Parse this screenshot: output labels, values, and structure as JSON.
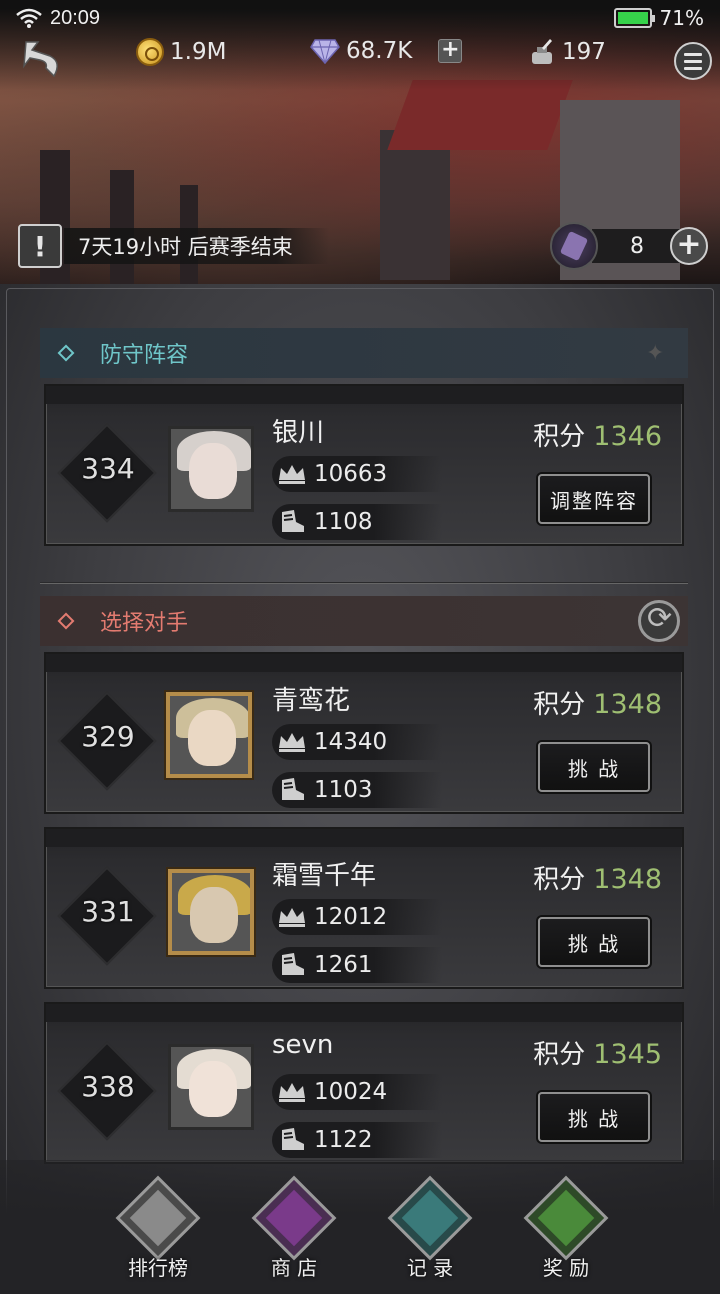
{
  "status_bar": {
    "time": "20:09",
    "battery": "71%"
  },
  "currency": {
    "gold": "1.9M",
    "gems": "68.7K",
    "ink": "197"
  },
  "season": {
    "text": "7天19小时 后赛季结束",
    "tickets": "8"
  },
  "defense": {
    "title": "防守阵容",
    "player": {
      "rank": "334",
      "name": "银川",
      "power": "10663",
      "level": "1108",
      "score_label": "积分",
      "score": "1346",
      "button": "调整阵容"
    }
  },
  "opponents": {
    "title": "选择对手",
    "list": [
      {
        "rank": "329",
        "name": "青鸾花",
        "power": "14340",
        "level": "1103",
        "score_label": "积分",
        "score": "1348",
        "button": "挑 战"
      },
      {
        "rank": "331",
        "name": "霜雪千年",
        "power": "12012",
        "level": "1261",
        "score_label": "积分",
        "score": "1348",
        "button": "挑 战"
      },
      {
        "rank": "338",
        "name": "sevn",
        "power": "10024",
        "level": "1122",
        "score_label": "积分",
        "score": "1345",
        "button": "挑 战"
      }
    ]
  },
  "nav": [
    {
      "label": "排行榜",
      "color": "#8a8a8a",
      "icon": "trophy-icon"
    },
    {
      "label": "商 店",
      "color": "#7a3a8a",
      "icon": "chest-icon"
    },
    {
      "label": "记 录",
      "color": "#3a7a7a",
      "icon": "scroll-icon"
    },
    {
      "label": "奖 励",
      "color": "#4a8a3a",
      "icon": "money-bag-icon"
    }
  ]
}
